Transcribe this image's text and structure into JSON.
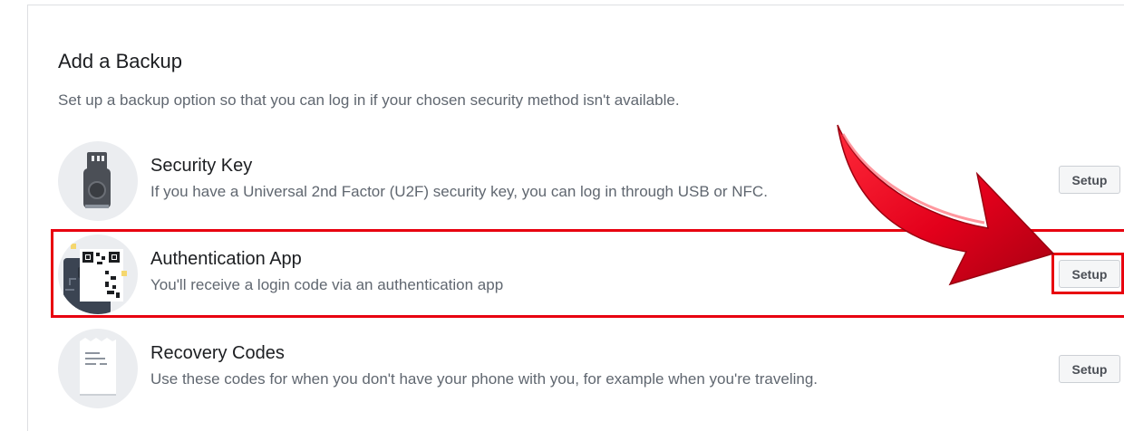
{
  "section": {
    "title": "Add a Backup",
    "subtitle": "Set up a backup option so that you can log in if your chosen security method isn't available."
  },
  "options": [
    {
      "title": "Security Key",
      "description": "If you have a Universal 2nd Factor (U2F) security key, you can log in through USB or NFC.",
      "button": "Setup",
      "icon": "usb-security-key-icon"
    },
    {
      "title": "Authentication App",
      "description": "You'll receive a login code via an authentication app",
      "button": "Setup",
      "icon": "qr-phone-icon"
    },
    {
      "title": "Recovery Codes",
      "description": "Use these codes for when you don't have your phone with you, for example when you're traveling.",
      "button": "Setup",
      "icon": "document-codes-icon"
    }
  ],
  "annotations": {
    "highlight_color": "#e8000f",
    "arrow_color": "#e3001b"
  }
}
